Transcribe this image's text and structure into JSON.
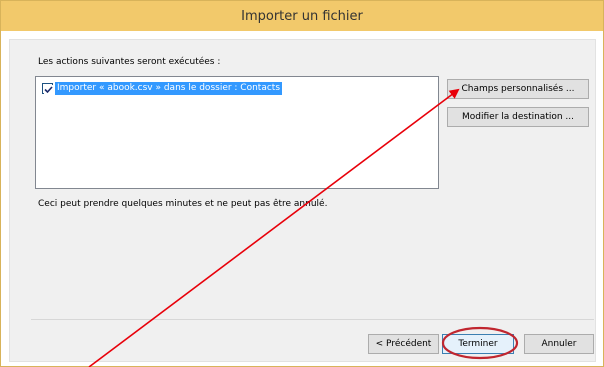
{
  "dialog": {
    "title": "Importer un fichier",
    "actions_label": "Les actions suivantes seront exécutées :",
    "action_items": [
      {
        "label": "Importer « abook.csv » dans le dossier : Contacts",
        "checked": true
      }
    ],
    "notice": "Ceci peut prendre quelques minutes et ne peut pas être annulé.",
    "side_buttons": {
      "custom_fields": "Champs personnalisés ...",
      "change_destination": "Modifier la destination ..."
    },
    "footer_buttons": {
      "previous": "< Précédent",
      "finish": "Terminer",
      "cancel": "Annuler"
    }
  },
  "annotations": {
    "color": "#e8000a"
  }
}
